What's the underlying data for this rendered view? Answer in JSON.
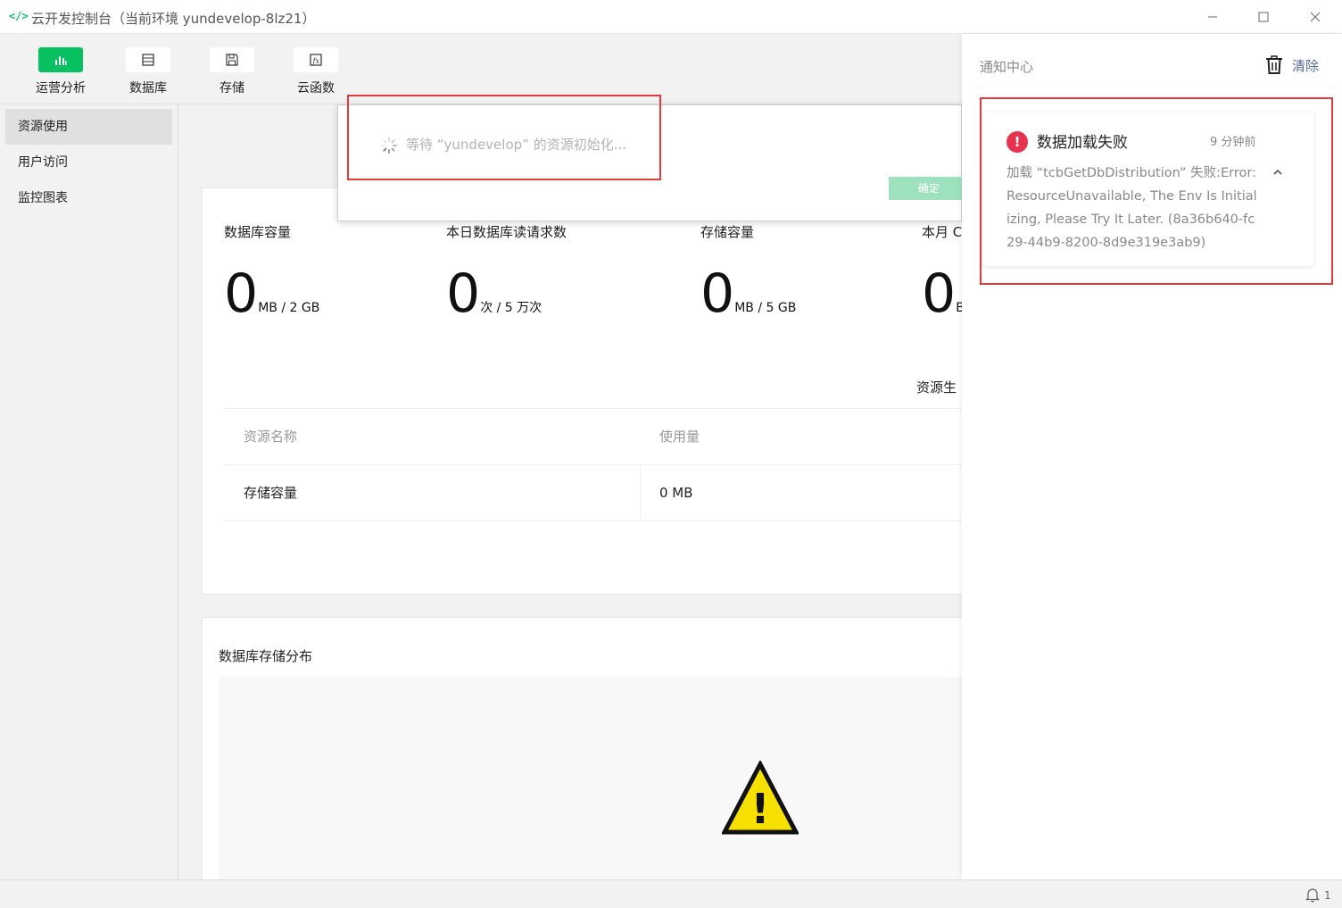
{
  "window": {
    "app_icon": "</>",
    "title": "云开发控制台（当前环境 yundevelop-8lz21）"
  },
  "toolbar": {
    "items": [
      {
        "label": "运营分析",
        "icon": "bar-chart-icon"
      },
      {
        "label": "数据库",
        "icon": "database-icon"
      },
      {
        "label": "存储",
        "icon": "save-icon"
      },
      {
        "label": "云函数",
        "icon": "function-icon"
      }
    ]
  },
  "sidebar": {
    "items": [
      {
        "label": "资源使用"
      },
      {
        "label": "用户访问"
      },
      {
        "label": "监控图表"
      }
    ]
  },
  "stats": [
    {
      "label": "数据库容量",
      "value": "0",
      "unit": "MB / 2 GB"
    },
    {
      "label": "本日数据库读请求数",
      "value": "0",
      "unit": "次 / 5 万次"
    },
    {
      "label": "存储容量",
      "value": "0",
      "unit": "MB / 5 GB"
    },
    {
      "label": "本月 C",
      "value": "0",
      "unit": "B"
    }
  ],
  "resource_section_label": "资源生",
  "table": {
    "headers": [
      "资源名称",
      "使用量"
    ],
    "rows": [
      [
        "存储容量",
        "0 MB"
      ]
    ]
  },
  "distribution": {
    "title": "数据库存储分布",
    "warning_glyph": "!"
  },
  "dialog": {
    "message": "等待 “yundevelop” 的资源初始化...",
    "ok_label": "确定"
  },
  "notifications": {
    "title": "通知中心",
    "clear_label": "清除",
    "items": [
      {
        "title": "数据加载失败",
        "time": "9 分钟前",
        "body": "加载 “tcbGetDbDistribution” 失败:Error: ResourceUnavailable, The Env Is Initializing, Please Try It Later. (8a36b640-fc29-44b9-8200-8d9e319e3ab9)"
      }
    ]
  },
  "statusbar": {
    "notification_count": "1"
  },
  "colors": {
    "accent": "#07c160",
    "error": "#e8334f",
    "link": "#576b95",
    "highlight": "#e33b3b"
  }
}
